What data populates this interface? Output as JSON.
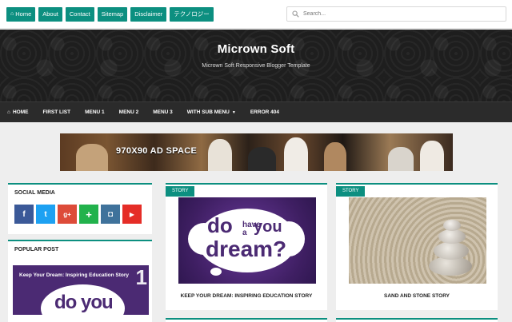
{
  "topbar": {
    "links": [
      "Home",
      "About",
      "Contact",
      "Sitemap",
      "Disclaimer",
      "テクノロジー"
    ],
    "search_placeholder": "Search..."
  },
  "header": {
    "title": "Micrown Soft",
    "description": "Micrown Soft Responsive Blogger Template"
  },
  "nav": {
    "items": [
      "HOME",
      "FIRST LIST",
      "MENU 1",
      "MENU 2",
      "MENU 3",
      "WITH SUB MENU",
      "ERROR 404"
    ]
  },
  "ad": {
    "label": "970X90 AD SPACE"
  },
  "sidebar": {
    "social_title": "SOCIAL MEDIA",
    "social_buttons": [
      {
        "glyph": "f",
        "color": "#3b5998"
      },
      {
        "glyph": "t",
        "color": "#1da1f2"
      },
      {
        "glyph": "g+",
        "color": "#dd4b39"
      },
      {
        "glyph": "+",
        "color": "#22b24c"
      },
      {
        "glyph": "◘",
        "color": "#3f729b"
      },
      {
        "glyph": "▶",
        "color": "#e52d27"
      }
    ],
    "popular_title": "POPULAR POST",
    "popular_caption": "Keep Your Dream: Inspiring Education Story",
    "popular_number": "1",
    "popular_thumb_text": "do you"
  },
  "posts": [
    {
      "tag": "STORY",
      "title": "KEEP YOUR DREAM: INSPIRING EDUCATION STORY",
      "image_text": {
        "do": "do",
        "you": "you",
        "have": "have",
        "a": "a",
        "dream": "dream?"
      }
    },
    {
      "tag": "STORY",
      "title": "SAND AND STONE STORY"
    }
  ],
  "colors": {
    "accent": "#0c8f80",
    "nav_bg": "#2b2b2b",
    "header_bg": "#1e1e1e",
    "page_bg": "#eeeeee"
  }
}
